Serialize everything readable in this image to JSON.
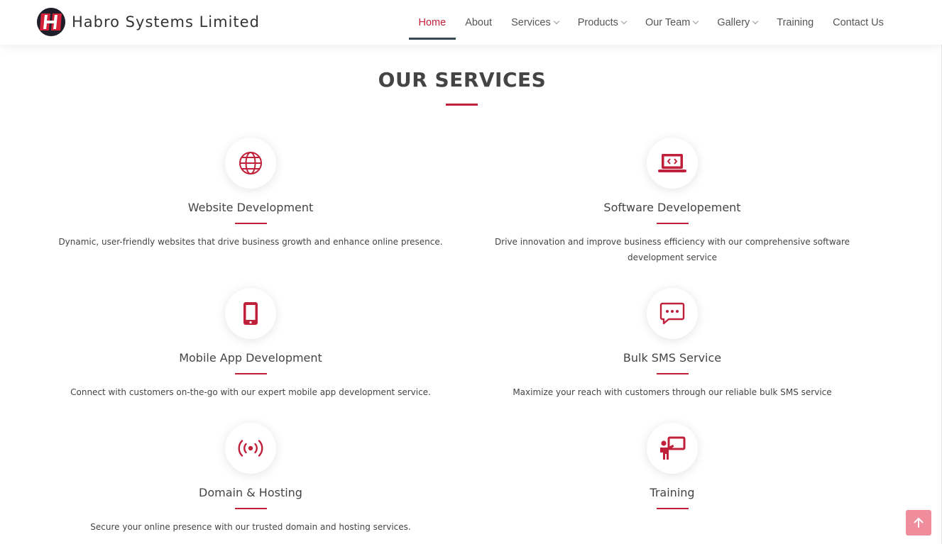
{
  "brand": {
    "name": "Habro Systems Limited"
  },
  "nav": {
    "items": [
      {
        "label": "Home",
        "active": true,
        "has_dropdown": false
      },
      {
        "label": "About",
        "active": false,
        "has_dropdown": false
      },
      {
        "label": "Services",
        "active": false,
        "has_dropdown": true
      },
      {
        "label": "Products",
        "active": false,
        "has_dropdown": true
      },
      {
        "label": "Our Team",
        "active": false,
        "has_dropdown": true
      },
      {
        "label": "Gallery",
        "active": false,
        "has_dropdown": true
      },
      {
        "label": "Training",
        "active": false,
        "has_dropdown": false
      },
      {
        "label": "Contact Us",
        "active": false,
        "has_dropdown": false
      }
    ]
  },
  "section": {
    "title": "OUR SERVICES"
  },
  "services": [
    {
      "icon": "globe-icon",
      "title": "Website Development",
      "desc": "Dynamic, user-friendly websites that drive business growth and enhance online presence."
    },
    {
      "icon": "laptop-code-icon",
      "title": "Software Developement",
      "desc": "Drive innovation and improve business efficiency with our comprehensive software development service"
    },
    {
      "icon": "phone-icon",
      "title": "Mobile App Development",
      "desc": "Connect with customers on-the-go with our expert mobile app development service."
    },
    {
      "icon": "chat-dots-icon",
      "title": "Bulk SMS Service",
      "desc": "Maximize your reach with customers through our reliable bulk SMS service"
    },
    {
      "icon": "broadcast-icon",
      "title": "Domain & Hosting",
      "desc": "Secure your online presence with our trusted domain and hosting services."
    },
    {
      "icon": "presenter-icon",
      "title": "Training",
      "desc": ""
    }
  ],
  "colors": {
    "accent": "#c0213a",
    "back_to_top": "#ef8d9c"
  }
}
